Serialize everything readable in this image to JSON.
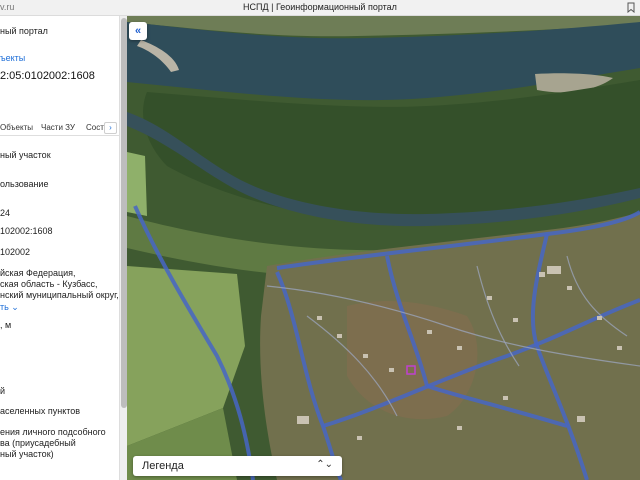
{
  "browser": {
    "url_fragment": "v.ru",
    "title": "НСПД | Геоинформационный портал"
  },
  "panel": {
    "portal_name": "ный портал",
    "objects_link": "ъекты",
    "cadastral_number": "2:05:0102002:1608",
    "tabs": [
      {
        "label": "Объекты"
      },
      {
        "label": "Части ЗУ"
      },
      {
        "label": "Состо"
      }
    ],
    "tab_next": "›",
    "fields": [
      {
        "text": "ный участок"
      },
      {
        "text": "ользование"
      },
      {
        "text": "24"
      },
      {
        "text": "102002:1608"
      },
      {
        "text": "102002"
      },
      {
        "text": "йская Федерация,"
      },
      {
        "text": "ская область - Кузбасс,"
      },
      {
        "text": "нский муниципальный округ,"
      },
      {
        "text": "ть ⌄"
      },
      {
        "text": ", м"
      },
      {
        "text": "й"
      },
      {
        "text": "аселенных пунктов"
      },
      {
        "text": "ения личного подсобного"
      },
      {
        "text": "ва (приусадебный"
      },
      {
        "text": "ный участок)"
      }
    ]
  },
  "map": {
    "collapse_button": "«",
    "legend_label": "Легенда",
    "legend_arrow": "⌃⌄"
  },
  "colors": {
    "accent": "#1f6fd8",
    "water": "#2f4d5a",
    "forest": "#2f4a25",
    "field": "#7e9a4f",
    "road": "#4666c4"
  }
}
